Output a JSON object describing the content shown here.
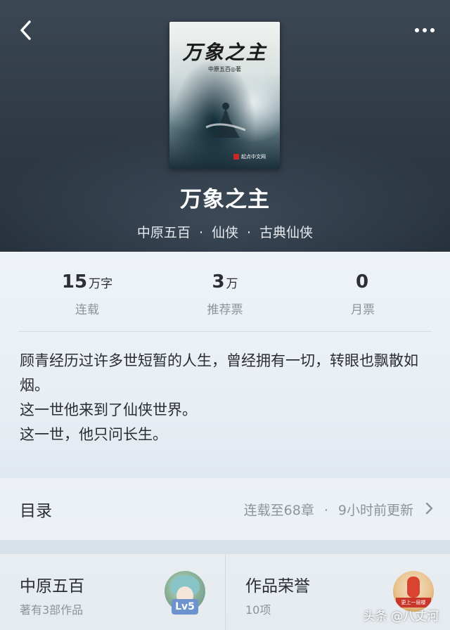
{
  "header": {
    "back_icon": "chevron-left-icon",
    "more_icon": "more-horizontal-icon"
  },
  "cover": {
    "title": "万象之主",
    "author_line": "中原五百◎著",
    "publisher": "起点中文网"
  },
  "book": {
    "title": "万象之主",
    "author": "中原五百",
    "category": "仙侠",
    "subcategory": "古典仙侠",
    "separator": "·"
  },
  "stats": [
    {
      "value": "15",
      "unit": "万字",
      "label": "连载"
    },
    {
      "value": "3",
      "unit": "万",
      "label": "推荐票"
    },
    {
      "value": "0",
      "unit": "",
      "label": "月票"
    }
  ],
  "intro": {
    "lines": [
      "顾青经历过许多世短暂的人生，曾经拥有一切，转眼也飘散如烟。",
      "这一世他来到了仙侠世界。",
      "这一世，他只问长生。"
    ]
  },
  "toc": {
    "label": "目录",
    "status": "连载至68章",
    "separator": "·",
    "updated": "9小时前更新",
    "arrow_icon": "chevron-right-icon"
  },
  "author_card": {
    "name": "中原五百",
    "works": "著有3部作品",
    "level": "Lv5"
  },
  "honor_card": {
    "title": "作品荣誉",
    "count": "10项",
    "ribbon": "更上一层楼"
  },
  "watermark": "头条 @八丈河",
  "colors": {
    "header_bg": "#2e3945",
    "text_primary": "#2a2e33",
    "text_secondary": "#8b949c",
    "level_badge": "#6d93cf"
  }
}
